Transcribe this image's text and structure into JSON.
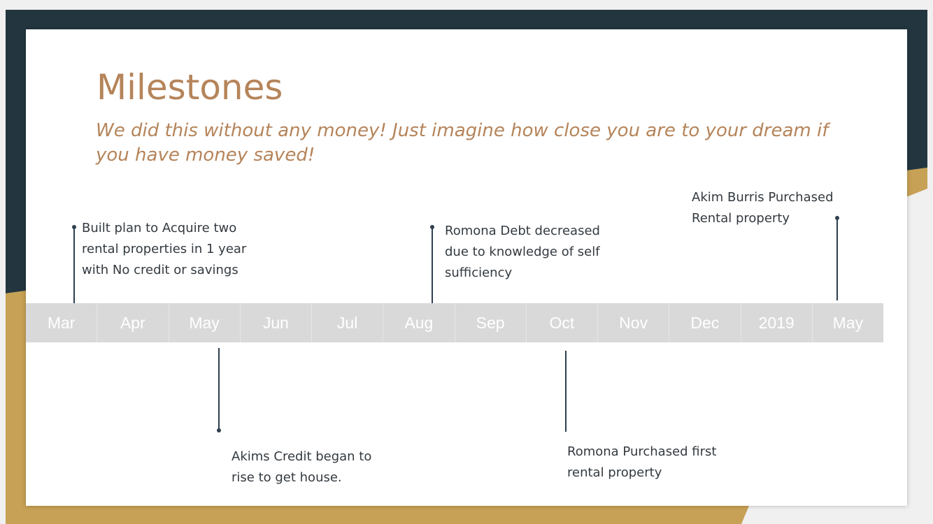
{
  "colors": {
    "dark_navy": "#23363f",
    "gold": "#c7a155",
    "title_brown": "#b5845a",
    "bar_gray": "#d9d9d9",
    "line": "#2f3f4d",
    "text": "#333a40"
  },
  "slide": {
    "title": "Milestones",
    "subtitle": "We did this without any money! Just imagine how close you are to your dream if you have money saved!"
  },
  "timeline": {
    "months": [
      "Mar",
      "Apr",
      "May",
      "Jun",
      "Jul",
      "Aug",
      "Sep",
      "Oct",
      "Nov",
      "Dec",
      "2019",
      "May"
    ]
  },
  "milestones": {
    "built_plan": {
      "line1": "Built plan to Acquire two",
      "line2": "rental properties in 1 year",
      "line3": "with No credit or savings"
    },
    "credit_rise": {
      "line1": "Akims Credit  began to",
      "line2": "rise to get house."
    },
    "debt_decreased": {
      "line1": "Romona Debt decreased",
      "line2": "due to  knowledge of self",
      "line3": "sufficiency"
    },
    "romona_purchase": {
      "line1": "Romona Purchased first",
      "line2": "rental property"
    },
    "akim_purchase": {
      "line1": "Akim Burris Purchased",
      "line2": "Rental property"
    }
  }
}
